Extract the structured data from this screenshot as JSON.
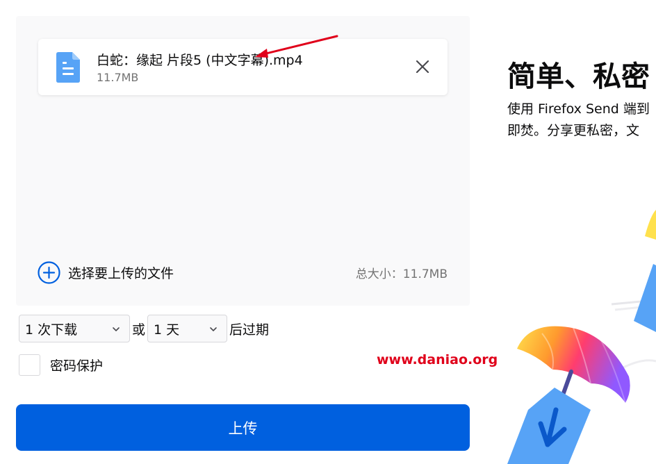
{
  "upload": {
    "file": {
      "name": "白蛇：缘起 片段5 (中文字幕).mp4",
      "size": "11.7MB"
    },
    "add_label": "选择要上传的文件",
    "total_size": "总大小：11.7MB"
  },
  "options": {
    "downloads_selected": "1 次下载",
    "connector": "或",
    "days_selected": "1 天",
    "suffix": "后过期",
    "password_label": "密码保护"
  },
  "upload_button_label": "上传",
  "hero": {
    "title": "简单、私密",
    "desc_line1": "使用 Firefox Send 端到",
    "desc_line2": "即焚。分享更私密，文"
  },
  "watermark": "www.daniao.org",
  "colors": {
    "accent": "#0060df",
    "file_icon": "#57a3f6",
    "annotation": "#e0001a"
  },
  "icons": {
    "file": "document-icon",
    "close": "close-icon",
    "add": "plus-circle-icon",
    "chevron": "chevron-down-icon"
  }
}
